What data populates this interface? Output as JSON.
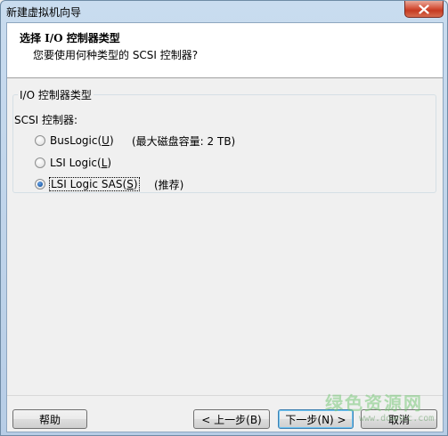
{
  "window": {
    "title": "新建虚拟机向导"
  },
  "header": {
    "title": "选择 I/O 控制器类型",
    "subtitle": "您要使用何种类型的 SCSI 控制器?"
  },
  "group": {
    "legend": "I/O 控制器类型",
    "scsi_label": "SCSI 控制器:",
    "options": [
      {
        "label_pre": "BusLogic(",
        "mnemonic": "U",
        "label_post": ")",
        "note": "(最大磁盘容量: 2 TB)",
        "selected": false
      },
      {
        "label_pre": "LSI Logic(",
        "mnemonic": "L",
        "label_post": ")",
        "note": "",
        "selected": false
      },
      {
        "label_pre": "LSI Logic SAS(",
        "mnemonic": "S",
        "label_post": ")",
        "note": "(推荐)",
        "selected": true
      }
    ]
  },
  "buttons": {
    "help": "帮助",
    "back": "< 上一步(B)",
    "next": "下一步(N) >",
    "cancel": "取消"
  },
  "watermark": {
    "main": "绿色资源网",
    "sub": "www.downcc.com"
  }
}
